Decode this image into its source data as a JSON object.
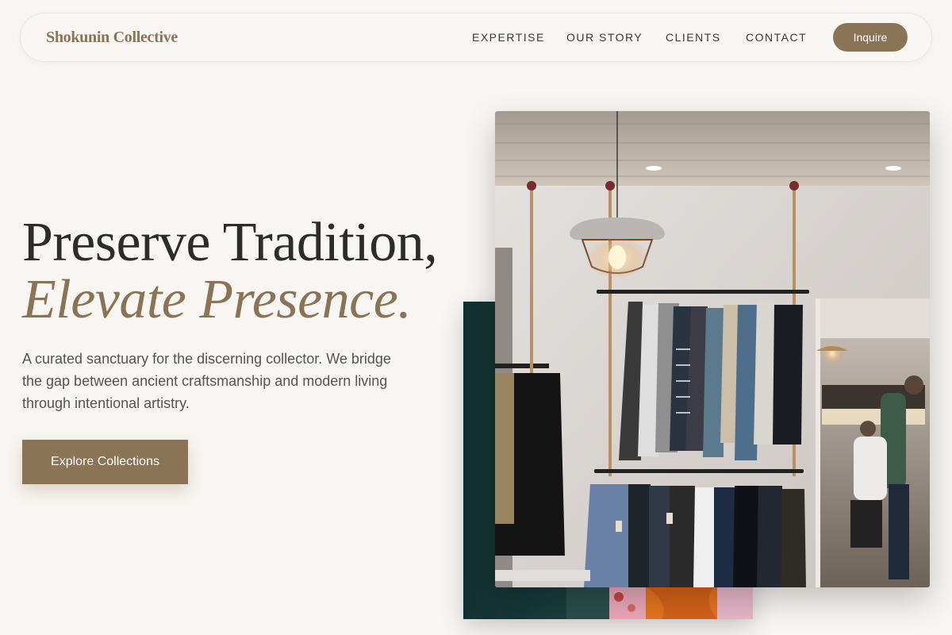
{
  "brand": {
    "name": "Shokunin Collective"
  },
  "nav": {
    "links": [
      "EXPERTISE",
      "OUR STORY",
      "CLIENTS",
      "CONTACT"
    ],
    "cta_label": "Inquire"
  },
  "hero": {
    "headline_line1": "Preserve Tradition,",
    "headline_line2": "Elevate Presence.",
    "description": "A curated sanctuary for the discerning collector. We bridge the gap between ancient craftsmanship and modern living through intentional artistry.",
    "cta_label": "Explore Collections"
  },
  "colors": {
    "accent": "#8b7355",
    "background": "#f8f6f2",
    "text": "#2c2c2c",
    "back_photo_teal": "#1a3d3c"
  }
}
